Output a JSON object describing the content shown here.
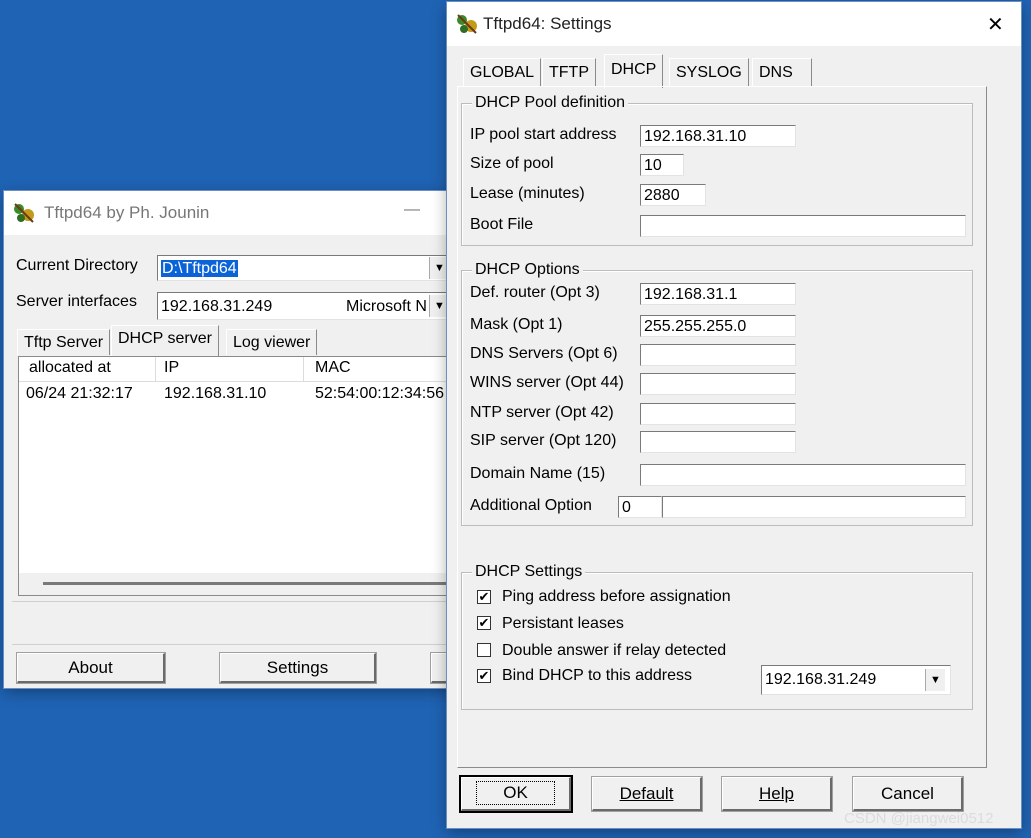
{
  "main_window": {
    "title": "Tftpd64 by Ph. Jounin",
    "minimize_glyph": "—",
    "current_directory_label": "Current Directory",
    "current_directory_value": "D:\\Tftpd64",
    "server_interfaces_label": "Server interfaces",
    "server_interface_ip": "192.168.31.249",
    "server_interface_name": "Microsoft N",
    "tabs": [
      "Tftp Server",
      "DHCP server",
      "Log viewer"
    ],
    "active_tab": "DHCP server",
    "table": {
      "columns": [
        "allocated at",
        "IP",
        "MAC"
      ],
      "rows": [
        [
          "06/24 21:32:17",
          "192.168.31.10",
          "52:54:00:12:34:56"
        ]
      ]
    },
    "buttons": {
      "about": "About",
      "settings": "Settings"
    }
  },
  "settings_window": {
    "title": "Tftpd64: Settings",
    "close_glyph": "✕",
    "tabs": [
      "GLOBAL",
      "TFTP",
      "DHCP",
      "SYSLOG",
      "DNS"
    ],
    "active_tab": "DHCP",
    "pool": {
      "title": "DHCP Pool definition",
      "start_label": "IP pool start address",
      "start_value": "192.168.31.10",
      "size_label": "Size of pool",
      "size_value": "10",
      "lease_label": "Lease (minutes)",
      "lease_value": "2880",
      "boot_label": "Boot File",
      "boot_value": ""
    },
    "options": {
      "title": "DHCP Options",
      "router_label": "Def. router (Opt 3)",
      "router_value": "192.168.31.1",
      "mask_label": "Mask (Opt 1)",
      "mask_value": "255.255.255.0",
      "dns_label": "DNS Servers (Opt 6)",
      "dns_value": "",
      "wins_label": "WINS server (Opt 44)",
      "wins_value": "",
      "ntp_label": "NTP server (Opt 42)",
      "ntp_value": "",
      "sip_label": "SIP server (Opt 120)",
      "sip_value": "",
      "domain_label": "Domain Name (15)",
      "domain_value": "",
      "additional_label": "Additional Option",
      "additional_num": "0",
      "additional_value": ""
    },
    "settings": {
      "title": "DHCP Settings",
      "ping_label": "Ping address before assignation",
      "ping_checked": true,
      "persistant_label": "Persistant leases",
      "persistant_checked": true,
      "double_label": "Double answer if relay detected",
      "double_checked": false,
      "bind_label": "Bind DHCP to this address",
      "bind_checked": true,
      "bind_address": "192.168.31.249"
    },
    "buttons": {
      "ok": "OK",
      "default": "Default",
      "help": "Help",
      "cancel": "Cancel"
    }
  },
  "watermark": "CSDN @jiangwei0512",
  "check_glyph": "✔",
  "dropdown_glyph": "▼"
}
